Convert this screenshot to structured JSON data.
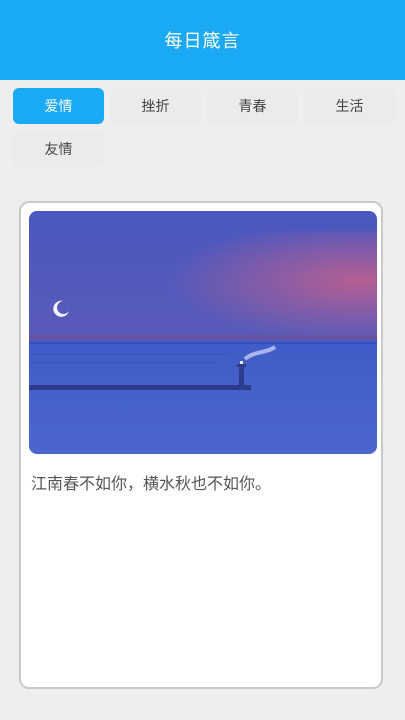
{
  "app": {
    "title": "每日箴言"
  },
  "tabs": [
    {
      "label": "爱情",
      "active": true
    },
    {
      "label": "挫折",
      "active": false
    },
    {
      "label": "青春",
      "active": false
    },
    {
      "label": "生活",
      "active": false
    },
    {
      "label": "友情",
      "active": false
    }
  ],
  "card": {
    "image": {
      "alt": "lighthouse-by-sea"
    },
    "quote": "江南春不如你，横水秋也不如你。"
  },
  "colors": {
    "accent": "#1aa9f3",
    "background": "#eeeeee"
  }
}
